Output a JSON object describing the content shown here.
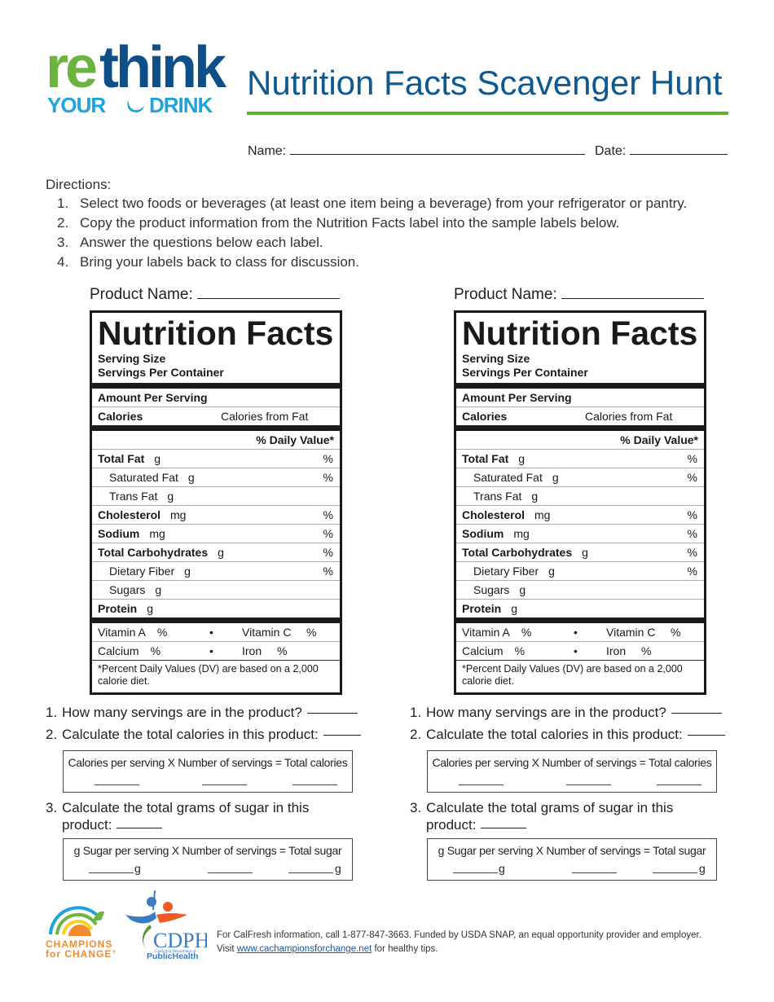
{
  "header": {
    "logo": {
      "part1": "re",
      "part2": "think",
      "part3": "YOUR",
      "part4": "DRINK",
      "icon": "water-drop-icon"
    },
    "title": "Nutrition Facts Scavenger Hunt",
    "name_label": "Name:",
    "date_label": "Date:",
    "name_value": "",
    "date_value": ""
  },
  "directions": {
    "heading": "Directions:",
    "items": [
      {
        "num": "1.",
        "text": "Select two foods or beverages (at least one item being a beverage) from your refrigerator or pantry."
      },
      {
        "num": "2.",
        "text": "Copy the product information from the Nutrition Facts label into the sample labels below."
      },
      {
        "num": "3.",
        "text": "Answer the questions below each label."
      },
      {
        "num": "4.",
        "text": "Bring your labels back to class for discussion."
      }
    ]
  },
  "label": {
    "product_name": "Product Name:",
    "title": "Nutrition Facts",
    "serving_size": "Serving Size",
    "servings_per_container": "Servings Per Container",
    "amount_per_serving": "Amount Per Serving",
    "calories": "Calories",
    "calories_from_fat": "Calories from Fat",
    "daily_value": "% Daily Value*",
    "pct": "%",
    "nutrients": [
      {
        "name": "Total Fat",
        "unit": "g"
      },
      {
        "name": "Saturated Fat",
        "unit": "g"
      },
      {
        "name": "Trans Fat",
        "unit": "g"
      },
      {
        "name": "Cholesterol",
        "unit": "mg"
      },
      {
        "name": "Sodium",
        "unit": "mg"
      },
      {
        "name": "Total Carbohydrates",
        "unit": "g"
      },
      {
        "name": "Dietary Fiber",
        "unit": "g"
      },
      {
        "name": "Sugars",
        "unit": "g"
      },
      {
        "name": "Protein",
        "unit": "g"
      }
    ],
    "vitamin_a": "Vitamin A",
    "vitamin_c": "Vitamin C",
    "calcium": "Calcium",
    "iron": "Iron",
    "bullet": "•",
    "footnote": "*Percent Daily Values (DV) are based on a 2,000 calorie diet."
  },
  "questions": {
    "q1_num": "1.",
    "q1": "How many servings are in the product?",
    "q2_num": "2.",
    "q2": "Calculate the total calories in this product:",
    "calories_formula": "Calories per serving  X  Number of servings  =  Total calories",
    "q3_num": "3.",
    "q3_line1": "Calculate the total grams of sugar in this",
    "q3_line2": "product:",
    "sugar_formula": "g Sugar per serving  X  Number of servings  =  Total sugar",
    "gram_unit": "g"
  },
  "footer": {
    "champions_logo": "CHAMPIONS",
    "champions_logo2": "for CHANGE™",
    "cdph_logo": "CDPH",
    "cdph_sub": "California Department of",
    "cdph_logo2": "PublicHealth",
    "line1": "For CalFresh information, call 1-877-847-3663. Funded by USDA SNAP, an equal opportunity provider and employer.",
    "line2_prefix": "Visit ",
    "link": "www.cachampionsforchange.net",
    "line2_suffix": " for healthy tips."
  },
  "colors": {
    "title_blue": "#0d5a92",
    "rule_green": "#5fae32",
    "logo_green": "#6cb33f",
    "logo_navy": "#0d4f86",
    "logo_cyan": "#1fa3dc"
  }
}
